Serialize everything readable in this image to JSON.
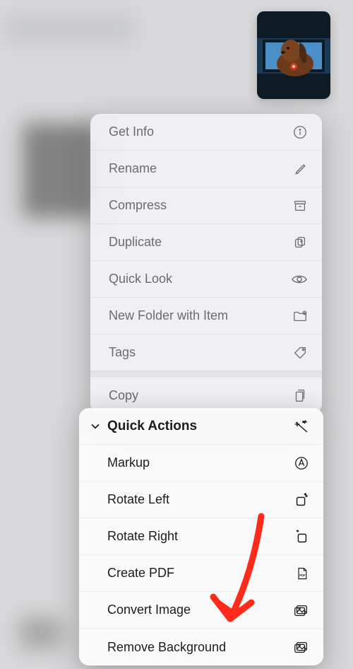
{
  "thumbnail": {
    "alt": "dog in car window photo"
  },
  "menu1": {
    "items": [
      {
        "label": "Get Info",
        "icon": "info-icon"
      },
      {
        "label": "Rename",
        "icon": "pencil-icon"
      },
      {
        "label": "Compress",
        "icon": "archive-icon"
      },
      {
        "label": "Duplicate",
        "icon": "duplicate-icon"
      },
      {
        "label": "Quick Look",
        "icon": "eye-icon"
      },
      {
        "label": "New Folder with Item",
        "icon": "new-folder-icon"
      },
      {
        "label": "Tags",
        "icon": "tag-icon"
      },
      {
        "label": "Copy",
        "icon": "copy-doc-icon"
      }
    ]
  },
  "menu2": {
    "header": "Quick Actions",
    "header_icon": "sparkles-icon",
    "items": [
      {
        "label": "Markup",
        "icon": "markup-icon"
      },
      {
        "label": "Rotate Left",
        "icon": "rotate-left-icon"
      },
      {
        "label": "Rotate Right",
        "icon": "rotate-right-icon"
      },
      {
        "label": "Create PDF",
        "icon": "pdf-icon"
      },
      {
        "label": "Convert Image",
        "icon": "images-icon"
      },
      {
        "label": "Remove Background",
        "icon": "images-icon"
      }
    ]
  }
}
